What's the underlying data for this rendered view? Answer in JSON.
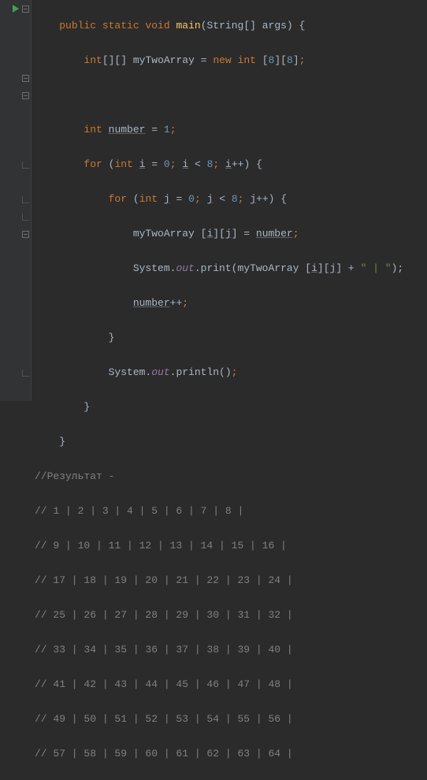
{
  "code": {
    "l1": {
      "kw1": "public static void",
      "fn": "main",
      "typ": "String",
      "args": "[] args) {"
    },
    "l2": {
      "kw": "int",
      "brackets": "[][]",
      "id": "myTwoArray",
      "eq": "=",
      "new": "new int",
      "dim1": "8",
      "dim2": "8"
    },
    "l4": {
      "kw": "int",
      "id": "number",
      "eq": "=",
      "val": "1"
    },
    "l5": {
      "kwfor": "for",
      "open": "(",
      "kwint": "int",
      "id": "i",
      "eq": "=",
      "zero": "0",
      "semi1": ";",
      "id2": "i",
      "lt": "<",
      "eight": "8",
      "semi2": ";",
      "id3": "i",
      "inc": "++",
      "close": ") {"
    },
    "l6": {
      "kwfor": "for",
      "open": "(",
      "kwint": "int",
      "id": "j",
      "eq": "=",
      "zero": "0",
      "semi1": ";",
      "id2": "j",
      "lt": "<",
      "eight": "8",
      "semi2": ";",
      "id3": "j",
      "inc": "++",
      "close": ") {"
    },
    "l7": {
      "arr": "myTwoArray [",
      "i": "i",
      "mid": "][",
      "j": "j",
      "close": "] =",
      "num": "number",
      "semi": ";"
    },
    "l8": {
      "sys": "System.",
      "out": "out",
      "dot": ".",
      "print": "print(myTwoArray [",
      "i": "i",
      "mid": "][",
      "j": "j",
      "close": "] +",
      "str": "\" | \"",
      "end": ");"
    },
    "l9": {
      "id": "number",
      "inc": "++",
      "semi": ";"
    },
    "l10": {
      "brace": "}"
    },
    "l11": {
      "sys": "System.",
      "out": "out",
      "dot": ".println()",
      "semi": ";"
    },
    "l12": {
      "brace": "}"
    },
    "l13": {
      "brace": "}"
    },
    "l14": {
      "comment": "//Результат -"
    },
    "r1": "// 1 | 2 | 3 | 4 | 5 | 6 | 7 | 8 |",
    "r2": "// 9 | 10 | 11 | 12 | 13 | 14 | 15 | 16 |",
    "r3": "// 17 | 18 | 19 | 20 | 21 | 22 | 23 | 24 |",
    "r4": "// 25 | 26 | 27 | 28 | 29 | 30 | 31 | 32 |",
    "r5": "// 33 | 34 | 35 | 36 | 37 | 38 | 39 | 40 |",
    "r6": "// 41 | 42 | 43 | 44 | 45 | 46 | 47 | 48 |",
    "r7": "// 49 | 50 | 51 | 52 | 53 | 54 | 55 | 56 |",
    "r8": "// 57 | 58 | 59 | 60 | 61 | 62 | 63 | 64 |"
  }
}
